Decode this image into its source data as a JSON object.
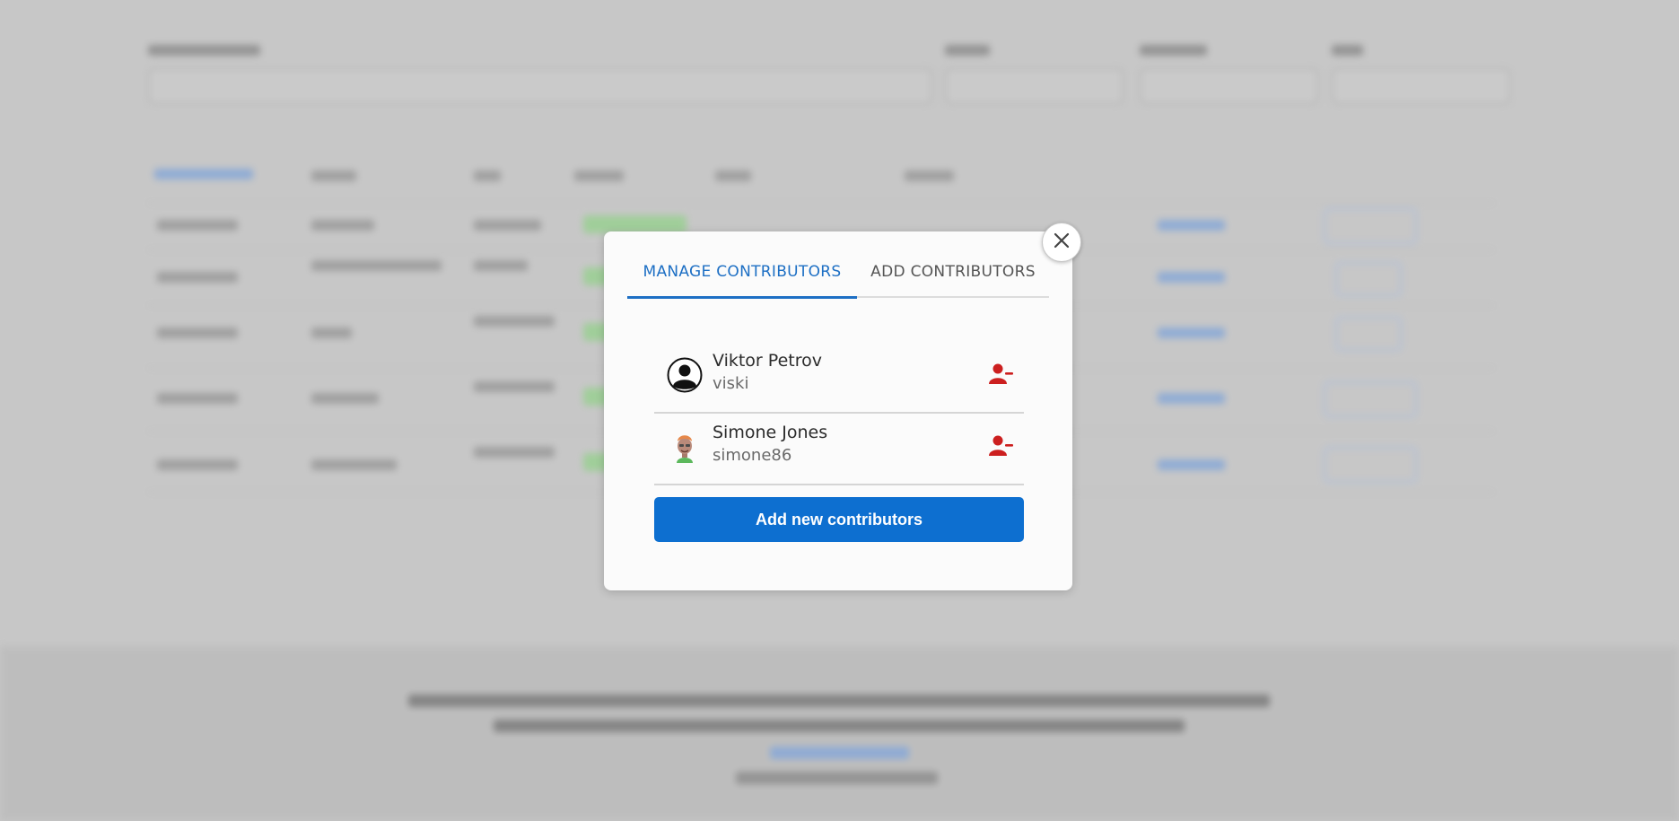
{
  "modal": {
    "tabs": [
      {
        "label": "MANAGE CONTRIBUTORS",
        "active": true
      },
      {
        "label": "ADD CONTRIBUTORS",
        "active": false
      }
    ],
    "contributors": [
      {
        "name": "Viktor Petrov",
        "username": "viski",
        "avatar": "default-user-avatar-icon"
      },
      {
        "name": "Simone Jones",
        "username": "simone86",
        "avatar": "cartoon-avatar-icon"
      }
    ],
    "add_button_label": "Add new contributors",
    "close_icon": "close-icon",
    "remove_icon": "remove-user-icon"
  },
  "colors": {
    "accent": "#1d6fc4",
    "button": "#0d6fd0",
    "remove": "#cc1f1f",
    "overlay": "#c7c7c7"
  }
}
